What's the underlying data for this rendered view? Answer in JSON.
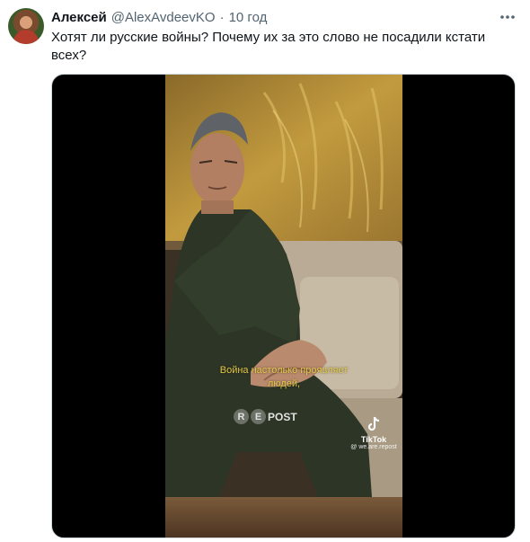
{
  "tweet": {
    "author": {
      "display_name": "Алексей",
      "handle": "@AlexAvdeevKO",
      "separator": "·",
      "time": "10 год"
    },
    "text": "Хотят ли русские войны? Почему их за это слово не посадили кстати всех?",
    "more_icon": "more-horizontal-icon",
    "media": {
      "type": "video-still",
      "caption_line1": "Война настолько проявляет",
      "caption_line2": "людей,",
      "watermark": {
        "r": "R",
        "e": "E",
        "post": "POST"
      },
      "tiktok": {
        "logo_icon": "tiktok-note-icon",
        "name": "TikTok",
        "user": "@ we.are.repost"
      }
    }
  }
}
